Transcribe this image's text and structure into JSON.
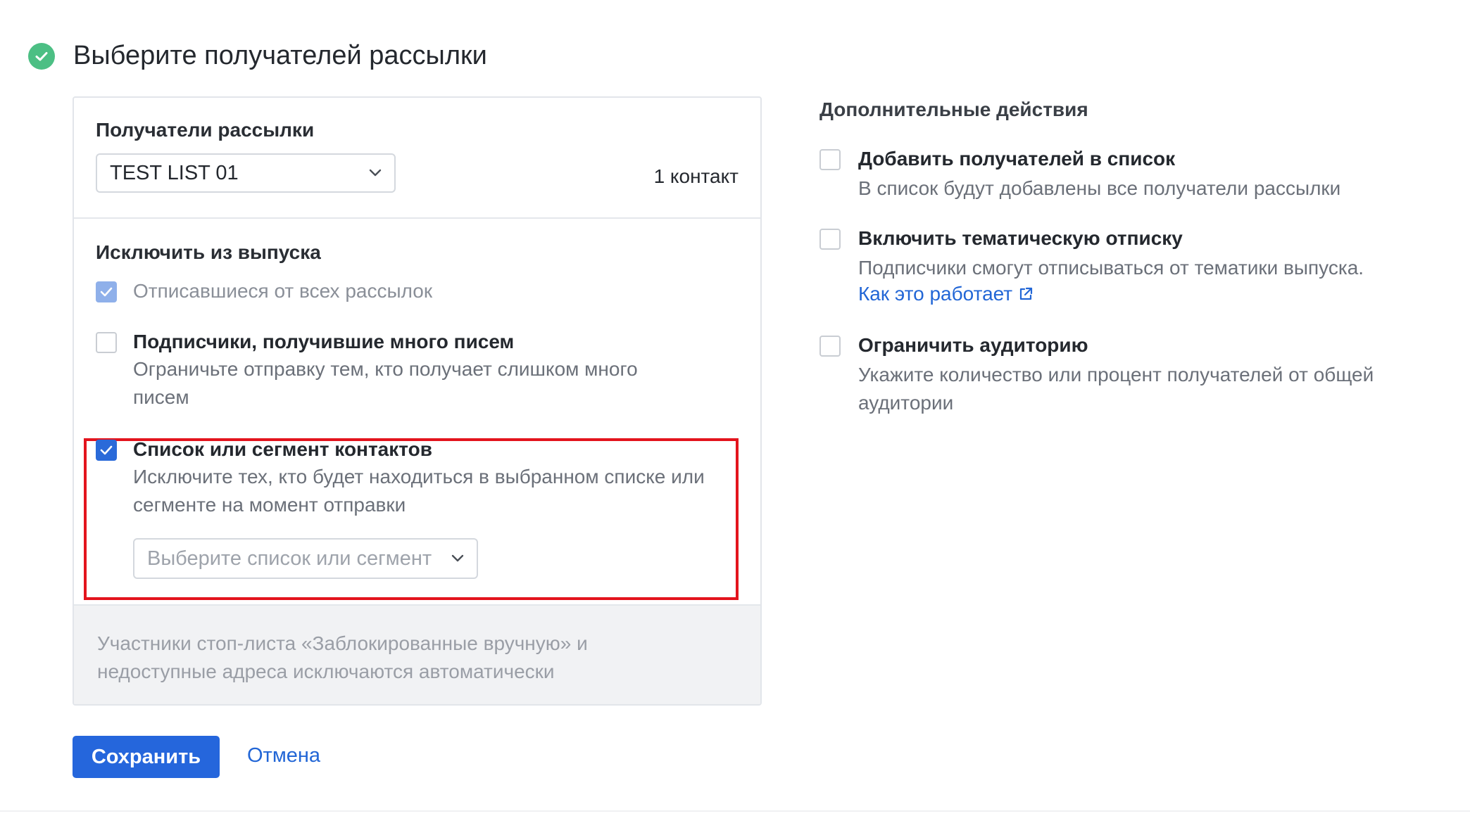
{
  "header": {
    "title": "Выберите получателей рассылки",
    "status_icon": "check-circle-icon",
    "status_color": "#4cbf84"
  },
  "recipients": {
    "label": "Получатели рассылки",
    "selected_list": "TEST LIST 01",
    "count": "1 контакт"
  },
  "exclude": {
    "label": "Исключить из выпуска",
    "options": [
      {
        "title": "Отписавшиеся от всех рассылок",
        "checked": true,
        "disabled": true
      },
      {
        "title": "Подписчики, получившие много писем",
        "description": "Ограничьте отправку тем, кто получает слишком много писем",
        "checked": false
      },
      {
        "title": "Список или сегмент контактов",
        "description": "Исключите тех, кто будет находиться в выбранном списке или сегменте на момент отправки",
        "checked": true,
        "select_placeholder": "Выберите список или сегмент"
      }
    ],
    "footer_note": "Участники стоп-листа «Заблокированные вручную» и недоступные адреса исключаются автоматически"
  },
  "additional": {
    "title": "Дополнительные действия",
    "options": [
      {
        "title": "Добавить получателей в список",
        "description": "В список будут добавлены все получатели рассылки",
        "checked": false
      },
      {
        "title": "Включить тематическую отписку",
        "description": "Подписчики смогут отписываться от тематики выпуска.",
        "link": "Как это работает",
        "link_icon": "external-link-icon",
        "checked": false
      },
      {
        "title": "Ограничить аудиторию",
        "description": "Укажите количество или процент получателей от общей аудитории",
        "checked": false
      }
    ]
  },
  "actions": {
    "save": "Сохранить",
    "cancel": "Отмена"
  },
  "colors": {
    "accent": "#2566dc",
    "highlight_border": "#e3141d",
    "checkbox_checked": "#2a6ad9",
    "checkbox_disabled_checked": "#8fb0ea",
    "link": "#2266d6"
  }
}
